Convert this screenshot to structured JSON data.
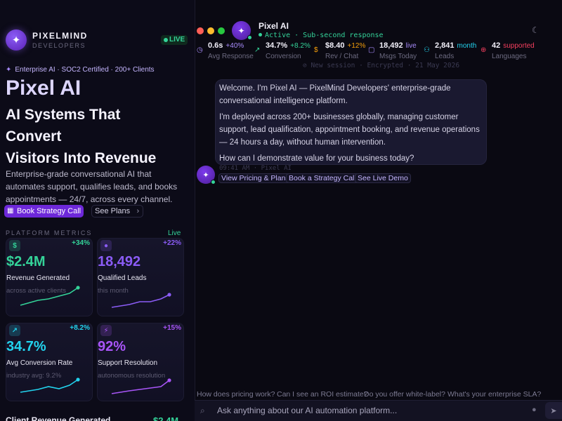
{
  "brand": {
    "name": "PIXELMIND",
    "sub": "DEVELOPERS",
    "logo_glyph": "✦",
    "live_label": "LIVE",
    "live_color": "#34d399"
  },
  "hero": {
    "tagline": "Enterprise AI · SOC2 Certified · 200+ Clients",
    "title": "Pixel AI",
    "subtitle_lines": [
      "AI Systems That",
      "Convert",
      "Visitors Into Revenue"
    ],
    "description": "Enterprise-grade conversational AI that automates support, qualifies leads, and books appointments — 24/7, across every channel.",
    "primary_cta": "Book Strategy Call",
    "secondary_cta": "See Plans"
  },
  "metrics": {
    "label": "PLATFORM METRICS",
    "live_label": "Live",
    "cards": [
      {
        "icon": "$",
        "icon_name": "dollar-icon",
        "delta": "+34%",
        "value": "$2.4M",
        "label": "Revenue Generated",
        "note": "across active clients",
        "color": "#34d399"
      },
      {
        "icon": "●",
        "icon_name": "leads-icon",
        "delta": "+22%",
        "value": "18,492",
        "label": "Qualified Leads",
        "note": "this month",
        "color": "#8b5cf6"
      },
      {
        "icon": "↗",
        "icon_name": "trend-up-icon",
        "delta": "+8.2%",
        "value": "34.7%",
        "label": "Avg Conversion Rate",
        "note": "industry avg: 9.2%",
        "color": "#22d3ee"
      },
      {
        "icon": "⚡",
        "icon_name": "bolt-icon",
        "delta": "+15%",
        "value": "92%",
        "label": "Support Resolution",
        "note": "autonomous resolution",
        "color": "#a855f7"
      }
    ],
    "footer_label": "Client Revenue Generated",
    "footer_value": "$2.4M"
  },
  "chat": {
    "agent_name": "Pixel AI",
    "status": "Active · Sub-second response",
    "stats": [
      {
        "icon": "◷",
        "icon_name": "clock-icon",
        "value": "0.6s",
        "delta": "+40%",
        "label": "Avg Response",
        "color": "#a78bfa"
      },
      {
        "icon": "↗",
        "icon_name": "trend-icon",
        "value": "34.7%",
        "delta": "+8.2%",
        "label": "Conversion",
        "color": "#34d399"
      },
      {
        "icon": "$",
        "icon_name": "dollar-icon",
        "value": "$8.40",
        "delta": "+12%",
        "label": "Rev / Chat",
        "color": "#f59e0b"
      },
      {
        "icon": "▢",
        "icon_name": "message-icon",
        "value": "18,492",
        "delta": "live",
        "label": "Msgs Today",
        "color": "#a78bfa"
      },
      {
        "icon": "⚇",
        "icon_name": "users-icon",
        "value": "2,841",
        "delta": "month",
        "label": "Leads",
        "color": "#22d3ee"
      },
      {
        "icon": "⊕",
        "icon_name": "globe-icon",
        "value": "42",
        "delta": "supported",
        "label": "Languages",
        "color": "#f43f5e"
      }
    ],
    "session": "⊘ New session · Encrypted · 21 May 2026",
    "message": {
      "paragraphs": [
        "Welcome. I'm Pixel AI — PixelMind Developers' enterprise-grade conversational intelligence platform.",
        "I'm deployed across 200+ businesses globally, managing customer support, lead qualification, appointment booking, and revenue operations — 24 hours a day, without human intervention.",
        "How can I demonstrate value for your business today?"
      ],
      "meta": "09:41 AM · Pixel AI"
    },
    "quick_replies": [
      "View Pricing & Plans",
      "Book a Strategy Call",
      "See Live Demo"
    ],
    "suggestions": [
      "How does pricing work?",
      "Can I see an ROI estimate?",
      "Do you offer white-label?",
      "What's your enterprise SLA?"
    ],
    "composer_placeholder": "Ask anything about our AI automation platform..."
  }
}
